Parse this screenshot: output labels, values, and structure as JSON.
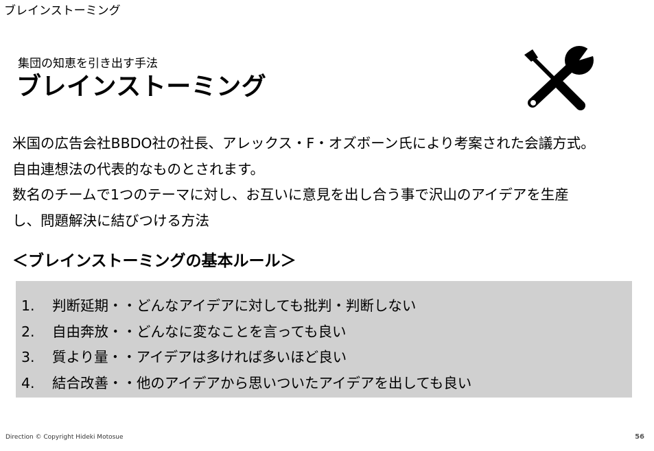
{
  "header": {
    "doc_title": "ブレインストーミング"
  },
  "slide": {
    "subtitle": "集団の知恵を引き出す手法",
    "title": "ブレインストーミング",
    "icon": "tools-icon",
    "body_lines": [
      "米国の広告会社BBDO社の社長、アレックス・F・オズボーン氏により考案された会議方式。",
      "自由連想法の代表的なものとされます。",
      "数名のチームで1つのテーマに対し、お互いに意見を出し合う事で沢山のアイデアを生産",
      "し、問題解決に結びつける方法"
    ],
    "rules_heading": "＜ブレインストーミングの基本ルール＞",
    "rules_box_color": "#d0d0d0",
    "rules": [
      {
        "number": "1.",
        "text": "判断延期・・どんなアイデアに対しても批判・判断しない"
      },
      {
        "number": "2.",
        "text": "自由奔放・・どんなに変なことを言っても良い"
      },
      {
        "number": "3.",
        "text": "質より量・・アイデアは多ければ多いほど良い"
      },
      {
        "number": "4.",
        "text": "結合改善・・他のアイデアから思いついたアイデアを出しても良い"
      }
    ]
  },
  "footer": {
    "copyright": "Direction © Copyright Hideki Motosue",
    "page_number": "56"
  }
}
